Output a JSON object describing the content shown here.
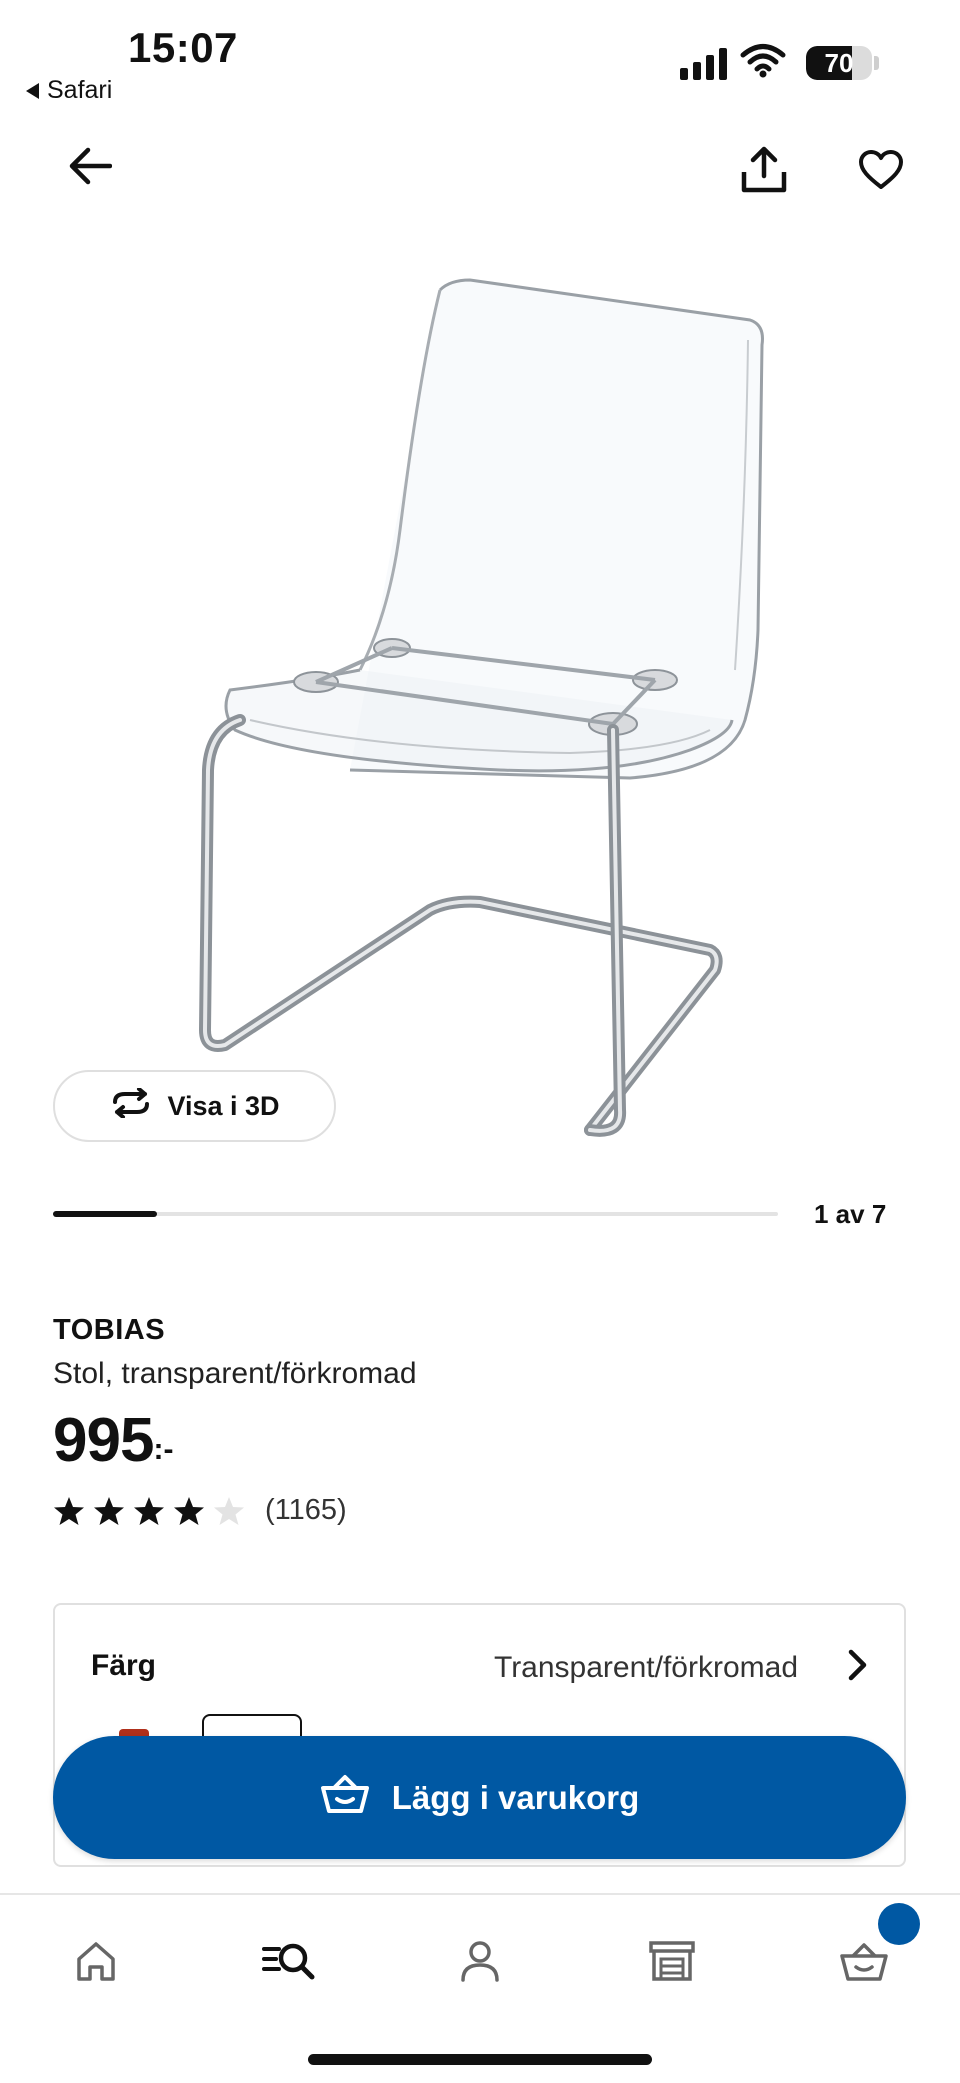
{
  "status_bar": {
    "time": "15:07",
    "back_app": "Safari",
    "battery": "70",
    "battery_level": 0.7,
    "signal_bars": 4,
    "icons": [
      "signal-icon",
      "wifi-icon",
      "battery-icon"
    ]
  },
  "top_nav": {
    "icons": [
      "back-arrow-icon",
      "share-icon",
      "heart-icon"
    ]
  },
  "gallery": {
    "view_3d_label": "Visa i 3D",
    "view_3d_icon": "rotate-3d-icon",
    "page_counter": "1 av 7",
    "current_index": 1,
    "total": 7
  },
  "product": {
    "name": "TOBIAS",
    "description": "Stol, transparent/förkromad",
    "price": "995",
    "price_suffix": ":-",
    "rating": 4,
    "rating_max": 5,
    "review_count": "(1165)"
  },
  "variant": {
    "label": "Färg",
    "value": "Transparent/förkromad"
  },
  "cart_button": {
    "label": "Lägg i varukorg",
    "icon": "basket-icon"
  },
  "bottom_nav": {
    "items": [
      "home-icon",
      "search-icon",
      "profile-icon",
      "store-icon",
      "cart-icon"
    ],
    "active": "search-icon"
  },
  "colors": {
    "brand_blue": "#0058a3",
    "text": "#111111",
    "swatch_red": "#b0301b"
  }
}
